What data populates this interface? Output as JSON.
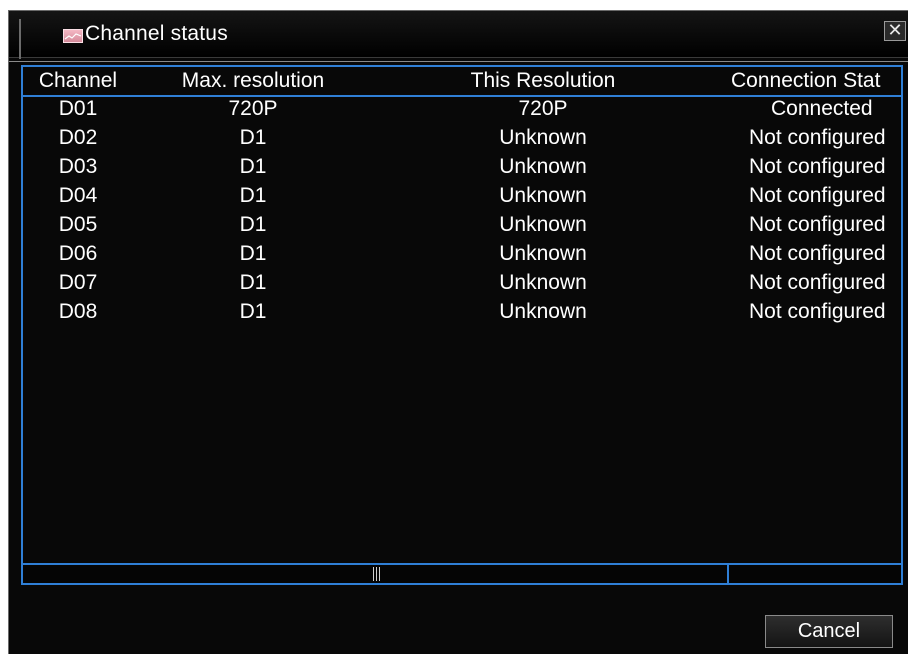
{
  "window": {
    "title": "Channel status",
    "close_symbol": "✕"
  },
  "table": {
    "headers": [
      "Channel",
      "Max. resolution",
      "This Resolution",
      "Connection Stat"
    ],
    "rows": [
      [
        "D01",
        "720P",
        "720P",
        "Connected"
      ],
      [
        "D02",
        "D1",
        "Unknown",
        "Not configured"
      ],
      [
        "D03",
        "D1",
        "Unknown",
        "Not configured"
      ],
      [
        "D04",
        "D1",
        "Unknown",
        "Not configured"
      ],
      [
        "D05",
        "D1",
        "Unknown",
        "Not configured"
      ],
      [
        "D06",
        "D1",
        "Unknown",
        "Not configured"
      ],
      [
        "D07",
        "D1",
        "Unknown",
        "Not configured"
      ],
      [
        "D08",
        "D1",
        "Unknown",
        "Not configured"
      ]
    ]
  },
  "footer": {
    "cancel_label": "Cancel"
  },
  "colors": {
    "accent": "#2f7fd6",
    "background": "#080808",
    "text": "#ffffff"
  },
  "icons": {
    "title_icon": "chart-icon",
    "close_icon": "close-icon"
  }
}
